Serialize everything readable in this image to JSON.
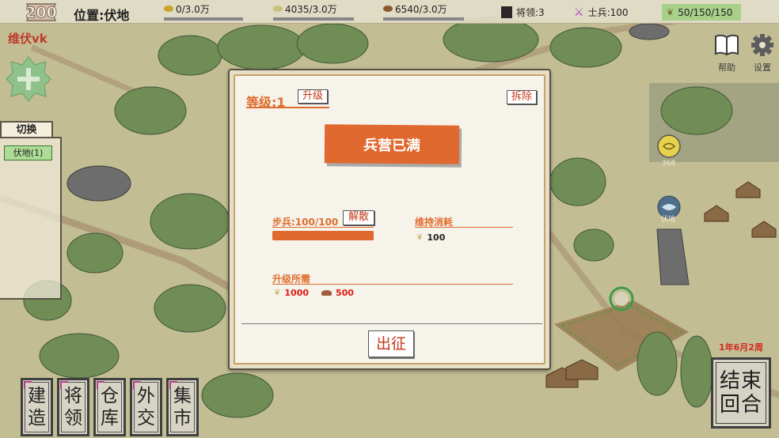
{
  "topbar": {
    "level": "200",
    "location": "位置:伏地",
    "gold": "0/3.0万",
    "wood": "4035/3.0万",
    "stone": "6540/3.0万",
    "generals": "将领:3",
    "soldiers": "士兵:100",
    "food": "50/150/150"
  },
  "sidebar": {
    "player_name": "维伏vk",
    "switch_tab": "切换",
    "items": [
      {
        "label": "伏地(1)"
      }
    ]
  },
  "right_controls": {
    "help_label": "帮助",
    "settings_label": "设置",
    "date": "1年6月2周",
    "end_turn": [
      "结束",
      "回合"
    ]
  },
  "bottom_menu": [
    {
      "lines": [
        "建",
        "造"
      ]
    },
    {
      "lines": [
        "将",
        "领"
      ]
    },
    {
      "lines": [
        "仓",
        "库"
      ]
    },
    {
      "lines": [
        "外",
        "交"
      ]
    },
    {
      "lines": [
        "集",
        "市"
      ]
    }
  ],
  "map_labels": {
    "unit_count": "368",
    "unit_name": "伏地"
  },
  "dialog": {
    "level_label": "等级:1",
    "upgrade_button": "升级",
    "demolish_button": "拆除",
    "status_banner": "兵营已满",
    "infantry_label": "步兵:100/100",
    "disband_button": "解散",
    "infantry_fill": 1.0,
    "upkeep_label": "维持消耗",
    "upkeep_food": "100",
    "upgrade_req_label": "升级所需",
    "req_wood": "1000",
    "req_stone": "500",
    "march_button": "出征"
  },
  "colors": {
    "accent": "#e0692f",
    "warning_text": "#e01b10",
    "dialog_bg": "#f5f3ea",
    "food_chip": "#a7d08a"
  }
}
